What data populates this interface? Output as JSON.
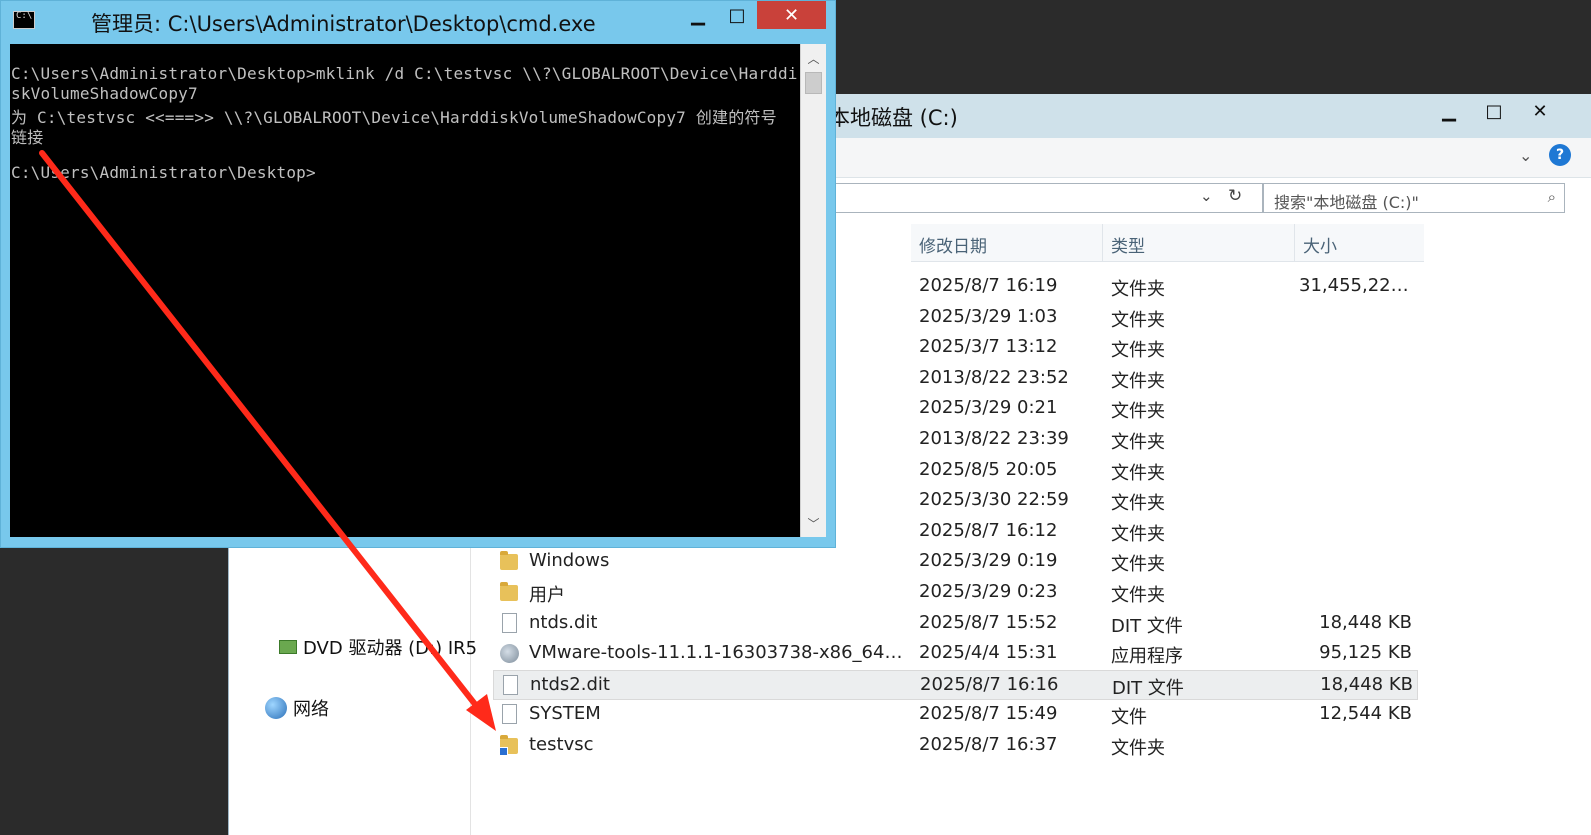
{
  "colors": {
    "cmd_frame": "#78c8ec",
    "cmd_close": "#c9413a",
    "console_bg": "#000000",
    "console_text": "#c0c0c0",
    "explorer_titlebar": "#cfe1ea",
    "annotation_arrow": "#ff2a1a"
  },
  "cmd": {
    "title": "管理员: C:\\Users\\Administrator\\Desktop\\cmd.exe",
    "icon": "console-icon",
    "lines": [
      "C:\\Users\\Administrator\\Desktop>mklink /d C:\\testvsc \\\\?\\GLOBALROOT\\Device\\Harddi",
      "skVolumeShadowCopy7",
      "为 C:\\testvsc <<===>> \\\\?\\GLOBALROOT\\Device\\HarddiskVolumeShadowCopy7 创建的符号",
      "链接",
      "",
      "C:\\Users\\Administrator\\Desktop>"
    ]
  },
  "explorer": {
    "title": "本地磁盘 (C:)",
    "search_placeholder": "搜索\"本地磁盘 (C:)\"",
    "nav": {
      "dvd": "DVD 驱动器 (D:) IR5",
      "network": "网络"
    },
    "columns": {
      "date": "修改日期",
      "type": "类型",
      "size": "大小"
    },
    "rows": [
      {
        "name": "",
        "date": "2025/8/7 16:19",
        "type": "文件夹",
        "size": "31,455,228...",
        "icon": "folder-icon"
      },
      {
        "name": "",
        "date": "2025/3/29 1:03",
        "type": "文件夹",
        "size": "",
        "icon": "folder-icon"
      },
      {
        "name": "",
        "date": "2025/3/7 13:12",
        "type": "文件夹",
        "size": "",
        "icon": "folder-icon"
      },
      {
        "name": "",
        "date": "2013/8/22 23:52",
        "type": "文件夹",
        "size": "",
        "icon": "folder-icon"
      },
      {
        "name": "",
        "date": "2025/3/29 0:21",
        "type": "文件夹",
        "size": "",
        "icon": "folder-icon"
      },
      {
        "name": "",
        "date": "2013/8/22 23:39",
        "type": "文件夹",
        "size": "",
        "icon": "folder-icon"
      },
      {
        "name": "",
        "date": "2025/8/5 20:05",
        "type": "文件夹",
        "size": "",
        "icon": "folder-icon"
      },
      {
        "name": "",
        "date": "2025/3/30 22:59",
        "type": "文件夹",
        "size": "",
        "icon": "folder-icon"
      },
      {
        "name": "",
        "date": "2025/8/7 16:12",
        "type": "文件夹",
        "size": "",
        "icon": "folder-icon"
      },
      {
        "name": "Windows",
        "date": "2025/3/29 0:19",
        "type": "文件夹",
        "size": "",
        "icon": "folder-icon"
      },
      {
        "name": "用户",
        "date": "2025/3/29 0:23",
        "type": "文件夹",
        "size": "",
        "icon": "folder-icon"
      },
      {
        "name": "ntds.dit",
        "date": "2025/8/7 15:52",
        "type": "DIT 文件",
        "size": "18,448 KB",
        "icon": "file-icon"
      },
      {
        "name": "VMware-tools-11.1.1-16303738-x86_64.e...",
        "date": "2025/4/4 15:31",
        "type": "应用程序",
        "size": "95,125 KB",
        "icon": "app-icon"
      },
      {
        "name": "ntds2.dit",
        "date": "2025/8/7 16:16",
        "type": "DIT 文件",
        "size": "18,448 KB",
        "icon": "file-icon",
        "selected": true
      },
      {
        "name": "SYSTEM",
        "date": "2025/8/7 15:49",
        "type": "文件",
        "size": "12,544 KB",
        "icon": "file-icon"
      },
      {
        "name": "testvsc",
        "date": "2025/8/7 16:37",
        "type": "文件夹",
        "size": "",
        "icon": "folder-link-icon"
      }
    ]
  }
}
